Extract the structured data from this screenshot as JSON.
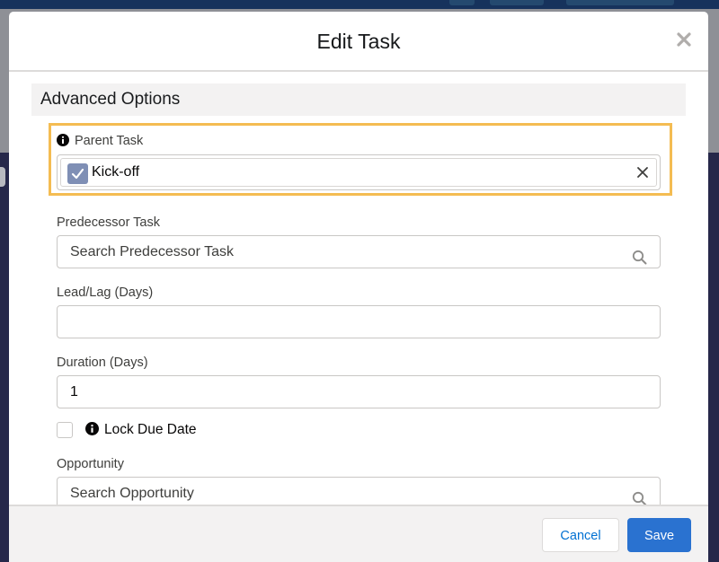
{
  "modal": {
    "title": "Edit Task",
    "section_title": "Advanced Options",
    "fields": {
      "parent_task": {
        "label": "Parent Task",
        "value": "Kick-off"
      },
      "predecessor_task": {
        "label": "Predecessor Task",
        "placeholder": "Search Predecessor Task"
      },
      "lead_lag": {
        "label": "Lead/Lag (Days)",
        "value": ""
      },
      "duration": {
        "label": "Duration (Days)",
        "value": "1"
      },
      "lock_due_date": {
        "label": "Lock Due Date",
        "checked": false
      },
      "opportunity": {
        "label": "Opportunity",
        "placeholder": "Search Opportunity"
      }
    },
    "buttons": {
      "cancel": "Cancel",
      "save": "Save"
    }
  },
  "icons": {
    "close": "close-icon",
    "info": "info-icon",
    "search": "search-icon",
    "check": "check-icon",
    "remove": "remove-icon"
  },
  "colors": {
    "highlight": "#f4bc52",
    "brand_button": "#2a72d0",
    "link": "#0070d2",
    "pill_icon": "#7f8fb5"
  }
}
